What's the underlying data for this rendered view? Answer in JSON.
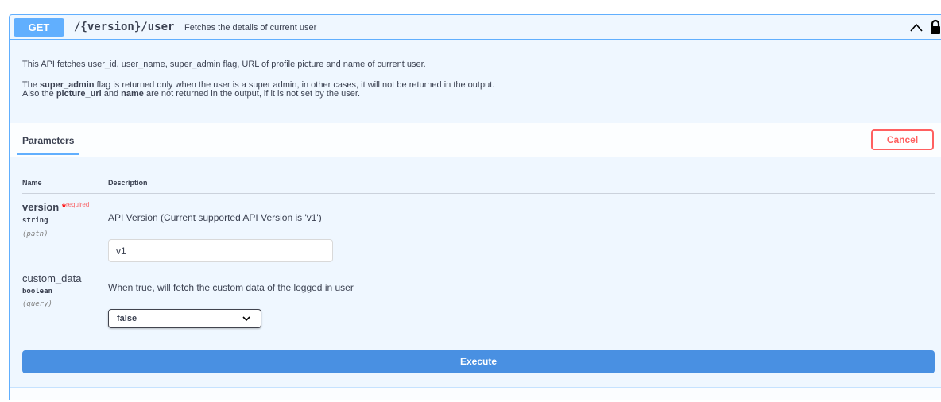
{
  "colors": {
    "get_accent": "#61affe",
    "execute": "#4990e2",
    "cancel": "#ff6060",
    "required": "#ff0000",
    "text": "#3b4151"
  },
  "operation": {
    "method": "GET",
    "path": "/{version}/user",
    "summary": "Fetches the details of current user",
    "toggle_icon": "chevron-up-icon",
    "auth_icon": "lock-icon"
  },
  "description": {
    "line1": "This API fetches user_id, user_name, super_admin flag, URL of profile picture and name of current user.",
    "line2_prefix": "The ",
    "line2_bold1": "super_admin",
    "line2_suffix": " flag is returned only when the user is a super admin, in other cases, it will not be returned in the output.",
    "line3_prefix": "Also the ",
    "line3_bold1": "picture_url",
    "line3_mid": " and ",
    "line3_bold2": "name",
    "line3_suffix": " are not returned in the output, if it is not set by the user."
  },
  "parameters_section": {
    "tab_label": "Parameters",
    "cancel_label": "Cancel",
    "col_name": "Name",
    "col_description": "Description"
  },
  "params": [
    {
      "name": "version",
      "required_star": "*",
      "required_label": "required",
      "type": "string",
      "in": "(path)",
      "description": "API Version (Current supported API Version is 'v1')",
      "value": "v1"
    },
    {
      "name": "custom_data",
      "type": "boolean",
      "in": "(query)",
      "description": "When true, will fetch the custom data of the logged in user",
      "selected": "false"
    }
  ],
  "execute_label": "Execute"
}
